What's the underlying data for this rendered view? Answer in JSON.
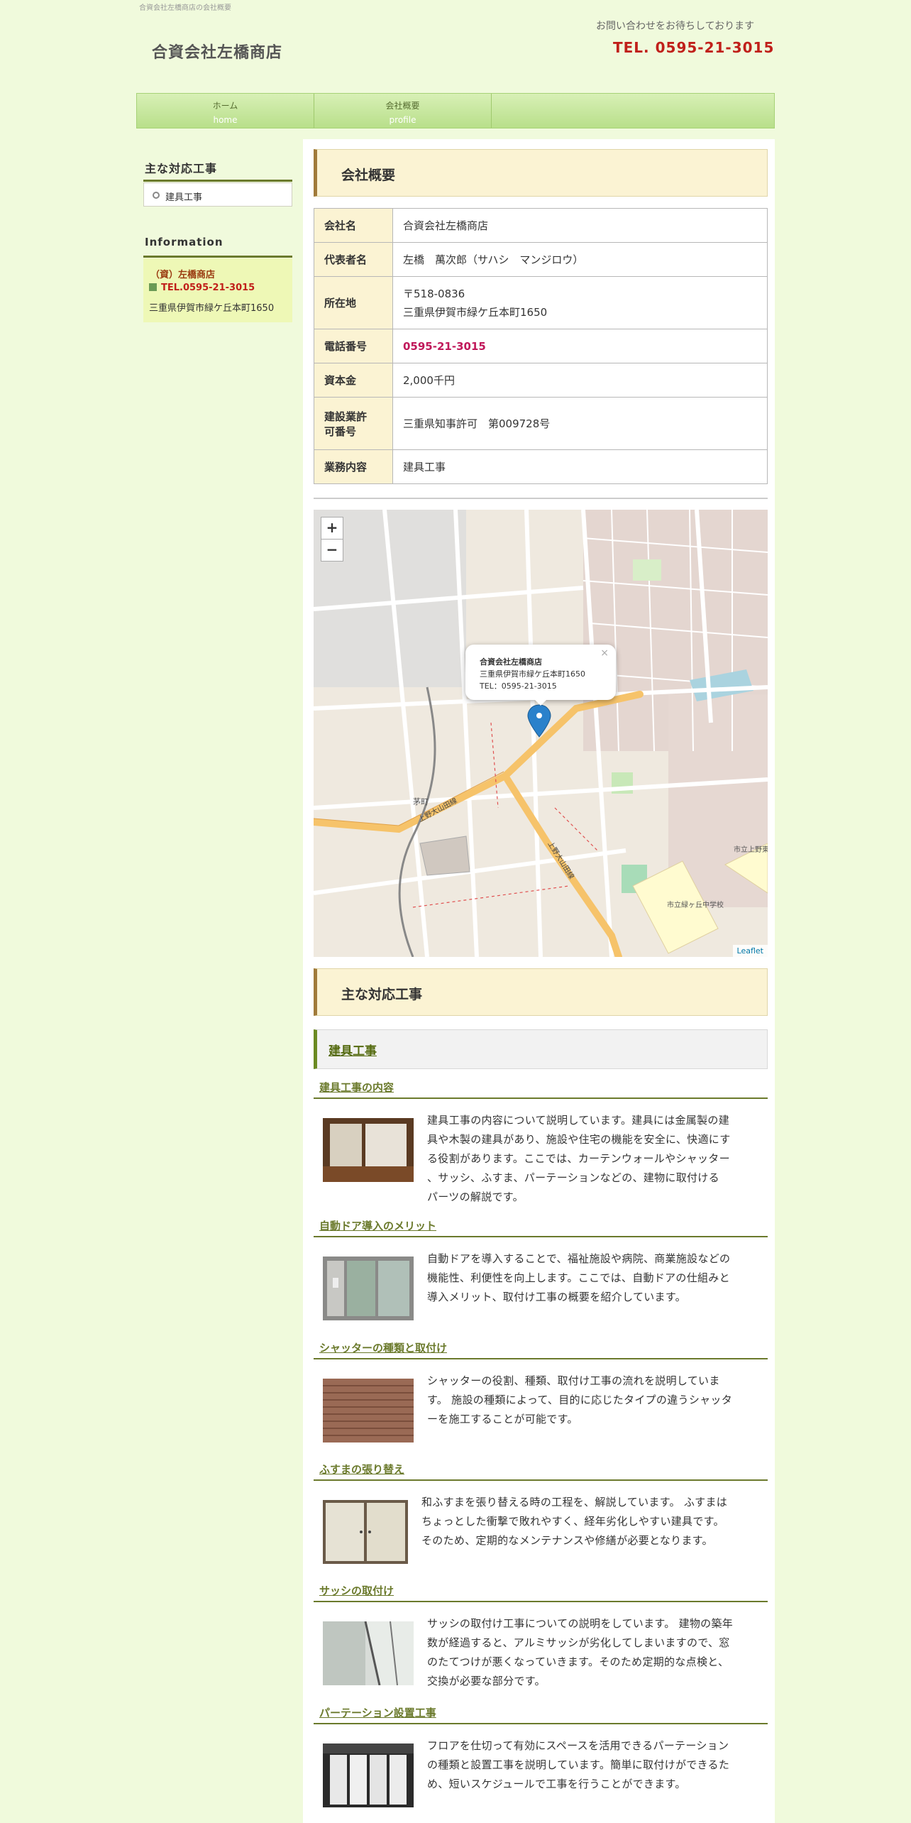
{
  "header": {
    "tagline": "合資会社左橋商店の会社概要",
    "site_title": "合資会社左橋商店",
    "contact_message": "お問い合わせをお待ちしております",
    "contact_tel": "TEL. 0595-21-3015"
  },
  "nav": {
    "items": [
      {
        "label": "ホーム",
        "sub": "home"
      },
      {
        "label": "会社概要",
        "sub": "profile"
      }
    ]
  },
  "sidebar": {
    "works_heading": "主な対応工事",
    "works_items": [
      "建具工事"
    ],
    "info_heading": "Information",
    "info_name": "（資）左橋商店",
    "info_tel": "TEL.0595-21-3015",
    "info_address": "三重県伊賀市緑ケ丘本町1650"
  },
  "company": {
    "heading": "会社概要",
    "rows": [
      {
        "label": "会社名",
        "value": "合資会社左橋商店"
      },
      {
        "label": "代表者名",
        "value": "左橋　萬次郎（サハシ　マンジロウ）"
      },
      {
        "label": "所在地",
        "value": "〒518-0836",
        "value2": "三重県伊賀市緑ケ丘本町1650"
      },
      {
        "label": "電話番号",
        "value": "0595-21-3015"
      },
      {
        "label": "資本金",
        "value": "2,000千円"
      },
      {
        "label": "建設業許",
        "label2": "可番号",
        "value": "三重県知事許可　第009728号"
      },
      {
        "label": "業務内容",
        "value": "建具工事"
      }
    ]
  },
  "map": {
    "zoom_in": "+",
    "zoom_out": "−",
    "popup_name": "合資会社左橋商店",
    "popup_address": "三重県伊賀市緑ケ丘本町1650",
    "popup_tel": "TEL：0595-21-3015",
    "popup_close": "×",
    "attribution": "Leaflet",
    "labels": {
      "station": "茅町",
      "road1": "上野大山田線",
      "road2": "上野大山田線",
      "school": "市立緑ヶ丘中学校",
      "school2": "市立上野東小学校"
    }
  },
  "works": {
    "heading": "主な対応工事",
    "category": "建具工事",
    "items": [
      {
        "title": "建具工事の内容",
        "text": [
          "建具工事の内容について説明しています。建具には金属製の建",
          "具や木製の建具があり、施設や住宅の機能を安全に、快適にす",
          "る役割があります。ここでは、カーテンウォールやシャッター",
          "、サッシ、ふすま、パーテーションなどの、建物に取付ける",
          "パーツの解説です。"
        ]
      },
      {
        "title": "自動ドア導入のメリット",
        "text": [
          "自動ドアを導入することで、福祉施設や病院、商業施設などの",
          "機能性、利便性を向上します。ここでは、自動ドアの仕組みと",
          "導入メリット、取付け工事の概要を紹介しています。"
        ]
      },
      {
        "title": "シャッターの種類と取付け",
        "text": [
          "シャッターの役割、種類、取付け工事の流れを説明していま",
          "す。 施設の種類によって、目的に応じたタイプの違うシャッタ",
          "ーを施工することが可能です。"
        ]
      },
      {
        "title": "ふすまの張り替え",
        "text": [
          "和ふすまを張り替える時の工程を、解説しています。 ふすまは",
          "ちょっとした衝撃で敗れやすく、経年劣化しやすい建具です。",
          "そのため、定期的なメンテナンスや修繕が必要となります。"
        ]
      },
      {
        "title": "サッシの取付け",
        "text": [
          "サッシの取付け工事についての説明をしています。 建物の築年",
          "数が経過すると、アルミサッシが劣化してしまいますので、窓",
          "のたてつけが悪くなっていきます。そのため定期的な点検と、",
          "交換が必要な部分です。"
        ]
      },
      {
        "title": "パーテーション設置工事",
        "text": [
          "フロアを仕切って有効にスペースを活用できるパーテーション",
          "の種類と設置工事を説明しています。簡単に取付けができるた",
          "め、短いスケジュールで工事を行うことができます。"
        ]
      }
    ]
  }
}
